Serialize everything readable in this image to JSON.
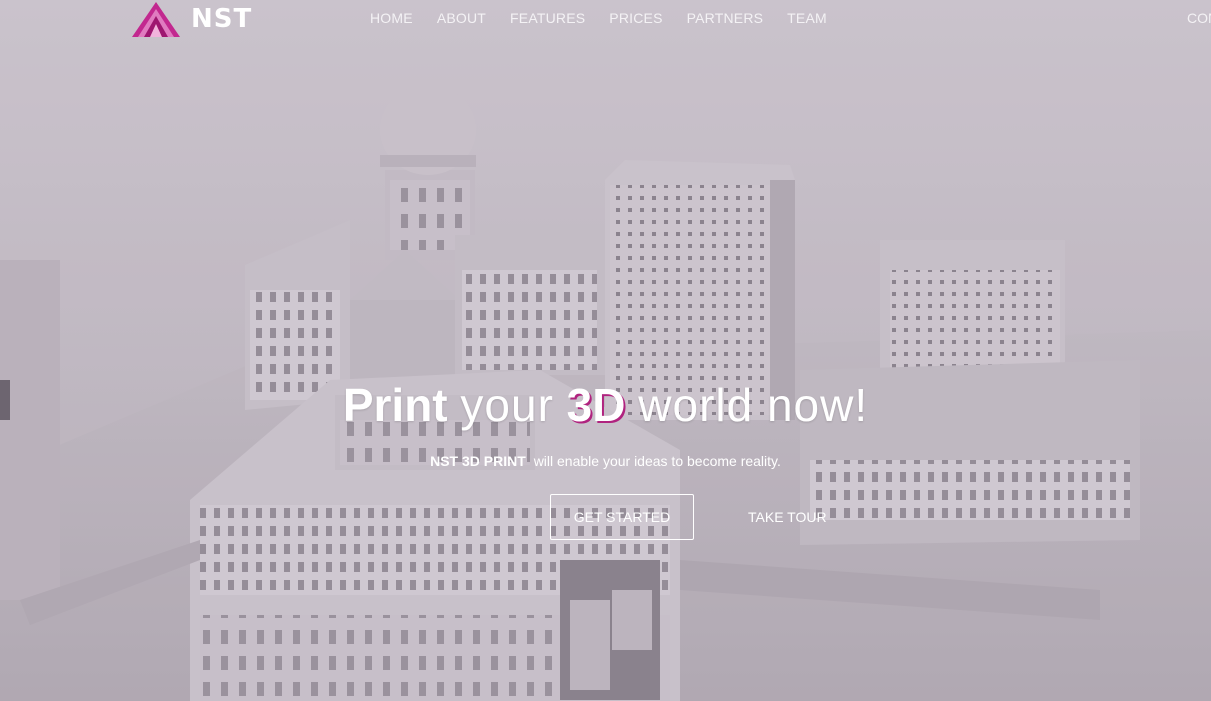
{
  "brand": {
    "logo_text": "NST",
    "logo_icon": "triangle-logo-icon",
    "accent_color": "#c2288f"
  },
  "nav": {
    "items": [
      {
        "label": "HOME"
      },
      {
        "label": "ABOUT"
      },
      {
        "label": "FEATURES"
      },
      {
        "label": "PRICES"
      },
      {
        "label": "PARTNERS"
      },
      {
        "label": "TEAM"
      }
    ],
    "cut_item": "CON"
  },
  "hero": {
    "headline": {
      "word1": "Print",
      "word2": "your",
      "word3": "3D",
      "word4": "world now!"
    },
    "subline": {
      "brand": "NST 3D PRINT",
      "text": "will enable your ideas to become reality."
    },
    "buttons": {
      "primary": "GET STARTED",
      "secondary": "TAKE TOUR"
    }
  }
}
